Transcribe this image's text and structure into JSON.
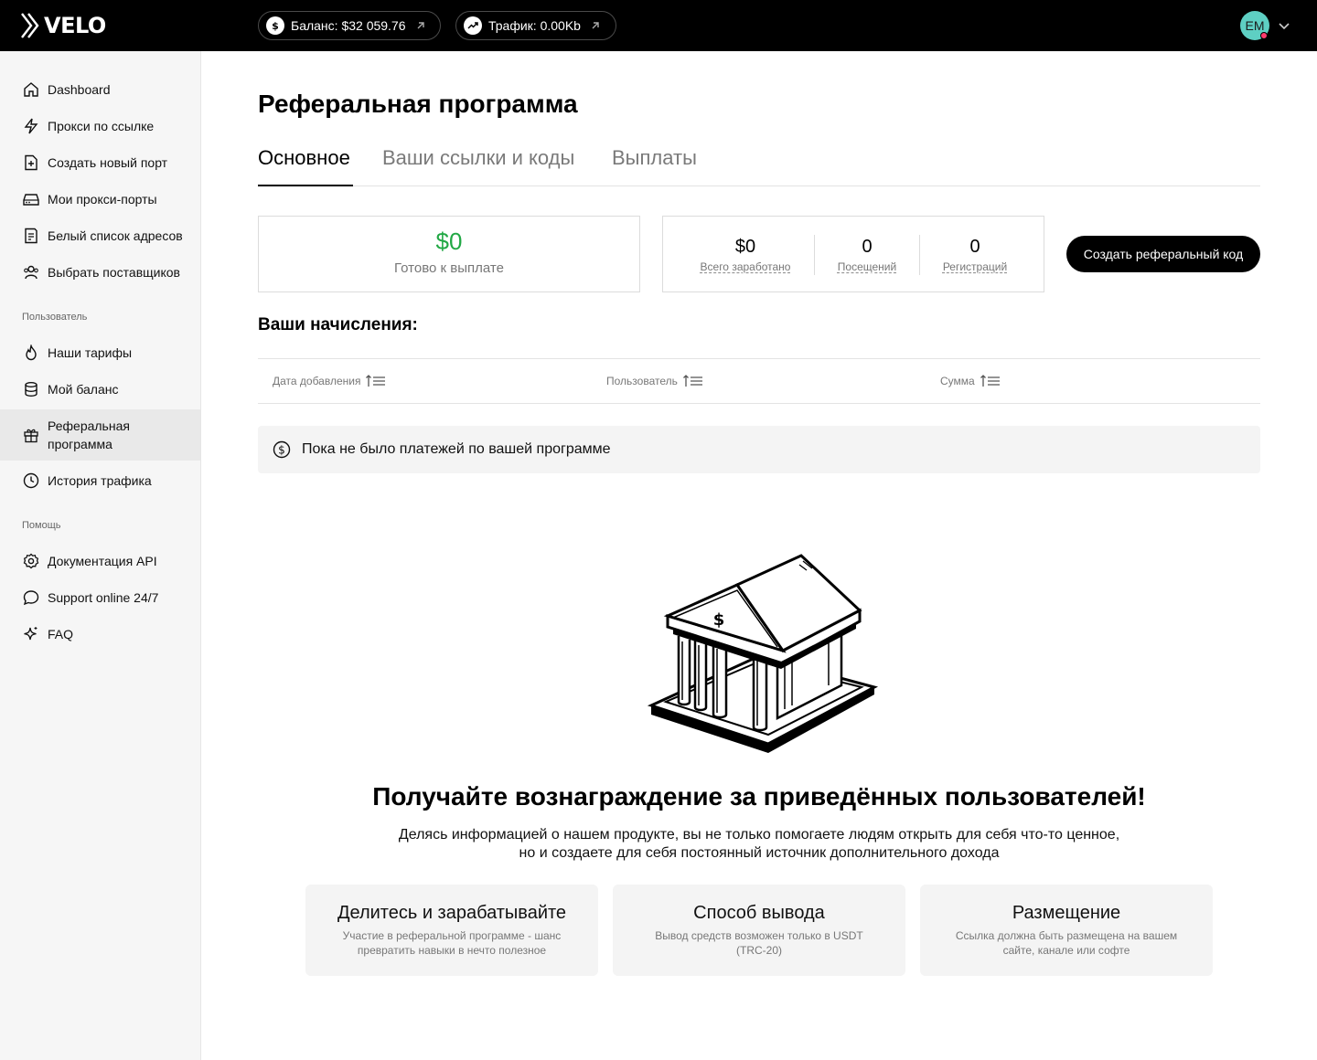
{
  "brand": {
    "logo_text": "VELO"
  },
  "header": {
    "balance_label": "Баланс: $32 059.76",
    "traffic_label": "Трафик: 0.00Kb",
    "avatar_initials": "EM"
  },
  "sidebar": {
    "items": [
      {
        "label": "Dashboard",
        "icon": "home-icon"
      },
      {
        "label": "Прокси по ссылке",
        "icon": "lightning-icon"
      },
      {
        "label": "Создать новый порт",
        "icon": "file-plus-icon"
      },
      {
        "label": "Мои прокси-порты",
        "icon": "server-icon"
      },
      {
        "label": "Белый список адресов",
        "icon": "list-icon"
      },
      {
        "label": "Выбрать поставщиков",
        "icon": "users-icon"
      }
    ],
    "section_user": "Пользователь",
    "user_items": [
      {
        "label": "Наши тарифы",
        "icon": "flame-icon"
      },
      {
        "label": "Мой баланс",
        "icon": "database-icon"
      },
      {
        "label": "Реферальная программа",
        "label_line1": "Реферальная",
        "label_line2": "программа",
        "icon": "gift-icon",
        "active": true
      },
      {
        "label": "История трафика",
        "icon": "clock-icon"
      }
    ],
    "section_help": "Помощь",
    "help_items": [
      {
        "label": "Документация API",
        "icon": "settings-icon"
      },
      {
        "label": "Support online 24/7",
        "icon": "chat-icon"
      },
      {
        "label": "FAQ",
        "icon": "sparkle-icon"
      }
    ]
  },
  "main": {
    "title": "Реферальная программа",
    "tabs": [
      {
        "label": "Основное",
        "active": true
      },
      {
        "label": "Ваши ссылки и коды",
        "active": false
      },
      {
        "label": "Выплаты",
        "active": false
      }
    ],
    "ready": {
      "amount": "$0",
      "label": "Готово к выплате"
    },
    "stats": [
      {
        "value": "$0",
        "label": "Всего заработано"
      },
      {
        "value": "0",
        "label": "Посещений"
      },
      {
        "value": "0",
        "label": "Регистраций"
      }
    ],
    "create_button": "Создать реферальный код",
    "earnings_title": "Ваши начисления:",
    "table_columns": [
      "Дата добавления",
      "Пользователь",
      "Сумма"
    ],
    "empty_message": "Пока не было платежей по вашей программе",
    "promo_title": "Получайте вознаграждение за приведённых пользователей!",
    "promo_line1": "Делясь информацией о нашем продукте, вы не только помогаете людям открыть для себя что-то ценное,",
    "promo_line2": "но и создаете для себя постоянный источник дополнительного дохода",
    "features": [
      {
        "title": "Делитесь и зарабатывайте",
        "desc": "Участие в реферальной программе - шанс превратить навыки в нечто полезное"
      },
      {
        "title": "Способ вывода",
        "desc": "Вывод средств возможен только в USDT (TRC-20)"
      },
      {
        "title": "Размещение",
        "desc": "Ссылка должна быть размещена на вашем сайте, канале или софте"
      }
    ]
  },
  "colors": {
    "accent_green": "#22a845",
    "topbar": "#000000",
    "avatar_bg": "#5ecfc3",
    "notify_dot": "#ff3b6e"
  }
}
